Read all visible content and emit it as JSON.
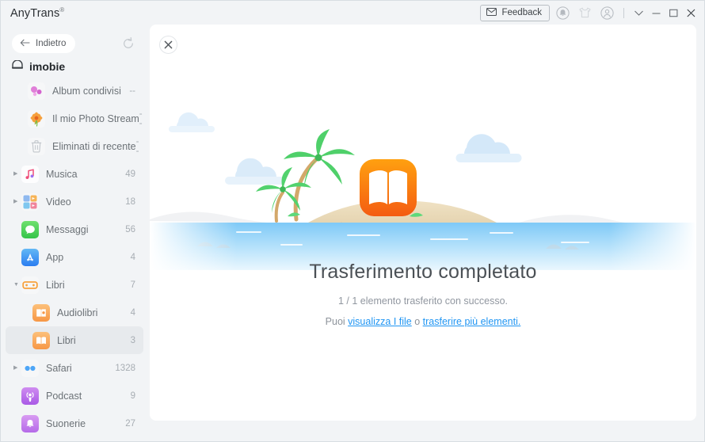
{
  "window": {
    "title": "AnyTrans",
    "registered_mark": "®"
  },
  "titlebar": {
    "feedback_label": "Feedback",
    "mail_icon": "mail-icon",
    "bell_icon": "bell-icon",
    "shirt_icon": "shirt-icon",
    "account_icon": "account-icon",
    "chevron_icon": "chevron-down-icon",
    "minimize_icon": "minimize-icon",
    "maximize_icon": "maximize-icon",
    "close_icon": "close-icon"
  },
  "sidebar": {
    "back_label": "Indietro",
    "back_icon": "arrow-left-icon",
    "refresh_icon": "refresh-icon",
    "device_name": "imobie",
    "device_icon": "device-icon",
    "items": [
      {
        "label": "Album condivisi",
        "count": "--",
        "icon": "shared-albums-icon",
        "indent": 1,
        "arrow": "",
        "selected": false
      },
      {
        "label": "Il mio Photo Stream",
        "count": "--",
        "icon": "photo-stream-icon",
        "indent": 1,
        "arrow": "",
        "selected": false
      },
      {
        "label": "Eliminati di recente",
        "count": "--",
        "icon": "trash-icon",
        "indent": 1,
        "arrow": "",
        "selected": false
      },
      {
        "label": "Musica",
        "count": "49",
        "icon": "music-icon",
        "indent": 0,
        "arrow": "▶",
        "selected": false
      },
      {
        "label": "Video",
        "count": "18",
        "icon": "video-icon",
        "indent": 0,
        "arrow": "▶",
        "selected": false
      },
      {
        "label": "Messaggi",
        "count": "56",
        "icon": "messages-icon",
        "indent": 0,
        "arrow": "",
        "selected": false
      },
      {
        "label": "App",
        "count": "4",
        "icon": "appstore-icon",
        "indent": 0,
        "arrow": "",
        "selected": false
      },
      {
        "label": "Libri",
        "count": "7",
        "icon": "books-group-icon",
        "indent": 0,
        "arrow": "▼",
        "selected": false
      },
      {
        "label": "Audiolibri",
        "count": "4",
        "icon": "audiobooks-icon",
        "indent": 1,
        "arrow": "",
        "selected": false
      },
      {
        "label": "Libri",
        "count": "3",
        "icon": "books-icon",
        "indent": 1,
        "arrow": "",
        "selected": true
      },
      {
        "label": "Safari",
        "count": "1328",
        "icon": "safari-icon",
        "indent": 0,
        "arrow": "▶",
        "selected": false
      },
      {
        "label": "Podcast",
        "count": "9",
        "icon": "podcast-icon",
        "indent": 0,
        "arrow": "",
        "selected": false
      },
      {
        "label": "Suonerie",
        "count": "27",
        "icon": "ringtones-icon",
        "indent": 0,
        "arrow": "",
        "selected": false
      }
    ]
  },
  "content": {
    "close_icon": "close-icon",
    "illustration": "island-with-books-app-icon",
    "title": "Trasferimento completato",
    "subtitle": "1 / 1 elemento trasferito con successo.",
    "links_prefix": "Puoi ",
    "link_view": "visualizza I file",
    "links_middle": " o ",
    "link_more": "trasferire più elementi.",
    "colors": {
      "link": "#2196f3",
      "books_orange": "#f86f1a",
      "sea": "#6cc4f5"
    }
  }
}
